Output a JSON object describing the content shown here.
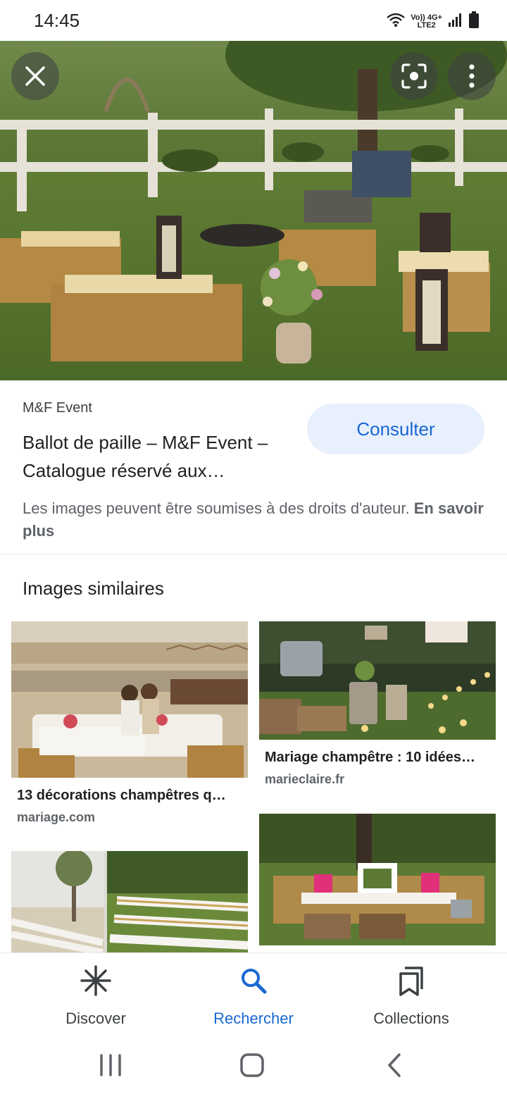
{
  "status_bar": {
    "time": "14:45",
    "network_top": "Vo)) 4G+",
    "network_bottom": "LTE2",
    "icons": [
      "wifi-icon",
      "signal-icon",
      "battery-icon"
    ]
  },
  "hero": {
    "buttons": [
      "close-icon",
      "lens-icon",
      "more-vert-icon"
    ]
  },
  "result": {
    "source": "M&F Event",
    "title": "Ballot de paille – M&F Event – Catalogue réservé aux…",
    "action_label": "Consulter",
    "copyright_text": "Les images peuvent être soumises à des droits d'auteur. ",
    "learn_more": "En savoir plus"
  },
  "similar": {
    "heading": "Images similaires",
    "items": [
      {
        "title": "13 décorations champêtres q…",
        "domain": "mariage.com"
      },
      {
        "title": "Mariage champêtre : 10 idées…",
        "domain": "marieclaire.fr"
      }
    ]
  },
  "bottom_nav": {
    "items": [
      {
        "label": "Discover",
        "icon": "asterisk-icon",
        "active": false
      },
      {
        "label": "Rechercher",
        "icon": "search-icon",
        "active": true
      },
      {
        "label": "Collections",
        "icon": "bookmarks-icon",
        "active": false
      }
    ]
  },
  "colors": {
    "accent": "#1967d2",
    "button_bg": "#e8f0fe",
    "text_primary": "#202124",
    "text_secondary": "#5f6368"
  }
}
